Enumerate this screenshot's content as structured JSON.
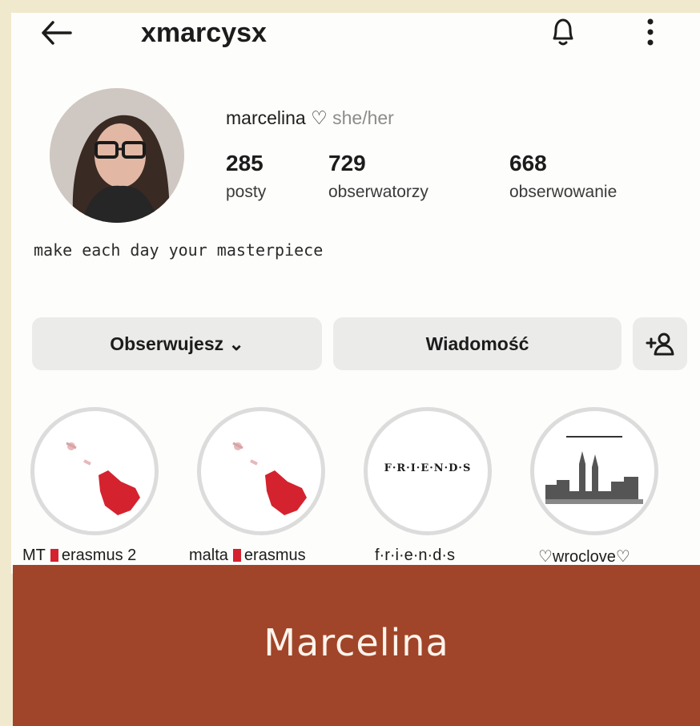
{
  "header": {
    "username": "xmarcysx"
  },
  "profile": {
    "display_name": "marcelina ♡",
    "pronouns": "she/her",
    "stats": [
      {
        "value": "285",
        "label": "posty"
      },
      {
        "value": "729",
        "label": "obserwatorzy"
      },
      {
        "value": "668",
        "label": "obserwowanie"
      }
    ],
    "bio": "make each day your masterpiece"
  },
  "actions": {
    "follow_label": "Obserwujesz ⌄",
    "message_label": "Wiadomość",
    "add_person_label": "+👤"
  },
  "highlights": [
    {
      "label": "MT",
      "label_after": "erasmus 2"
    },
    {
      "label": "malta",
      "label_after": "erasmus"
    },
    {
      "label": "f·r·i·e·n·d·s"
    },
    {
      "label": "♡wroclove♡"
    }
  ],
  "friends_text": "F·R·I·E·N·D·S",
  "banner": {
    "title": "Marcelina"
  },
  "colors": {
    "banner": "#a04529",
    "accent_red": "#d4232f",
    "page_bg": "#f1e9cd"
  }
}
